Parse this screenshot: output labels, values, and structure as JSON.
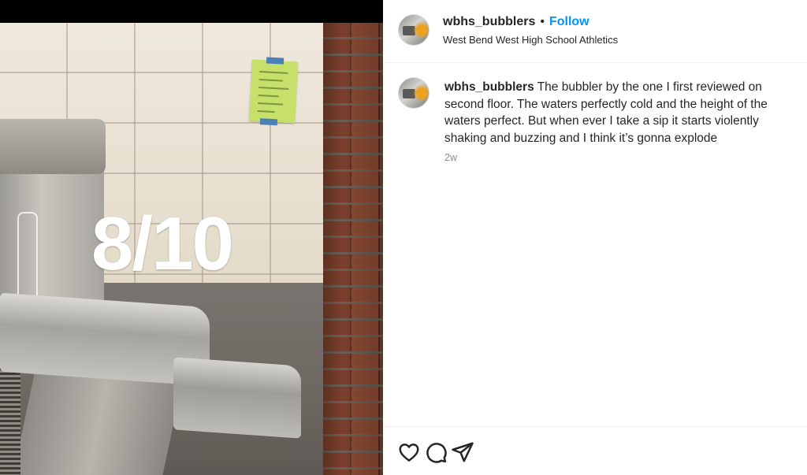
{
  "post": {
    "media": {
      "overlay_text": "8/10"
    },
    "header": {
      "username": "wbhs_bubblers",
      "separator": "•",
      "follow_label": "Follow",
      "subtitle": "West Bend West High School Athletics"
    },
    "caption": {
      "username": "wbhs_bubblers",
      "text": "The bubbler by the one I first reviewed on second floor. The waters perfectly cold and the height of the waters perfect. But when ever I take a sip it starts violently shaking and buzzing and I think it’s gonna explode",
      "time": "2w"
    },
    "actions": {
      "icons": [
        "heart-icon",
        "comment-icon",
        "share-icon"
      ]
    },
    "colors": {
      "follow": "#0095f6",
      "text": "#262626",
      "muted": "#8e8e8e"
    }
  }
}
